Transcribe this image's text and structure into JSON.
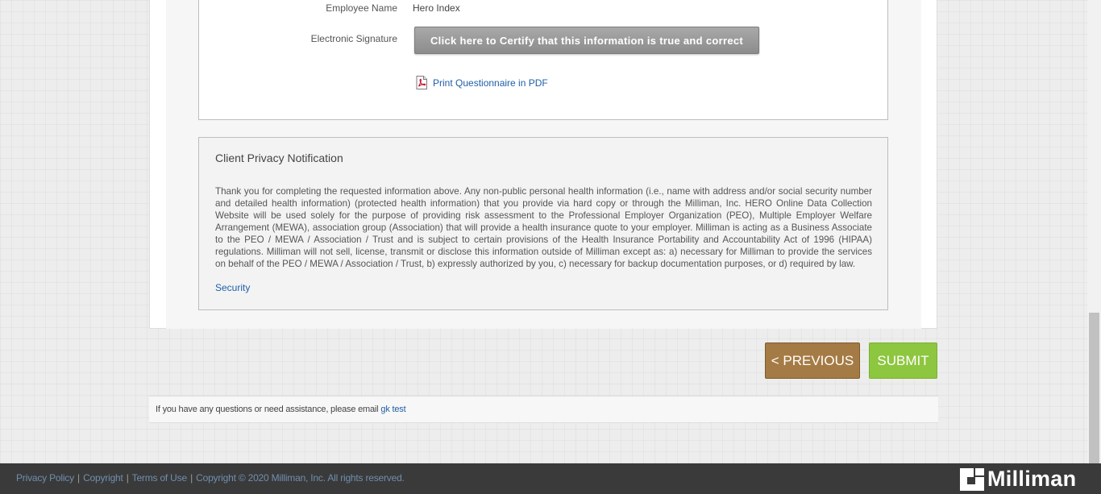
{
  "form": {
    "employee_name_label": "Employee Name",
    "employee_name_value": "Hero Index",
    "signature_label": "Electronic Signature",
    "certify_button": "Click here to Certify that this information is true and correct",
    "print_pdf_link": "Print Questionnaire in PDF"
  },
  "privacy": {
    "title": "Client Privacy Notification",
    "body": "Thank you for completing the requested information above. Any non-public personal health information (i.e., name with address and/or social security number and detailed health information) (protected health information) that you provide via hard copy or through the Milliman, Inc. HERO Online Data Collection Website will be used solely for the purpose of providing risk assessment to the Professional Employer Organization (PEO), Multiple Employer Welfare Arrangement (MEWA), association group (Association) that will provide a health insurance quote to your employer. Milliman is acting as a Business Associate to the PEO / MEWA / Association / Trust and is subject to certain provisions of the Health Insurance Portability and Accountability Act of 1996 (HIPAA) regulations. Milliman will not sell, license, transmit or disclose this information outside of Milliman except as: a) necessary for Milliman to provide the services on behalf of the PEO / MEWA / Association / Trust, b) expressly authorized by you, c) necessary for backup documentation purposes, or d) required by law.",
    "security_link": "Security"
  },
  "nav": {
    "previous_button": "< PREVIOUS",
    "submit_button": "SUBMIT"
  },
  "help": {
    "text": "If you have any questions or need assistance, please email",
    "link": "gk test"
  },
  "footer": {
    "privacy_policy": "Privacy Policy",
    "copyright": "Copyright",
    "terms_of_use": "Terms of Use",
    "copyright_notice": "Copyright © 2020 Milliman, Inc. All rights reserved.",
    "separator": "|",
    "logo_text": "Milliman"
  },
  "colors": {
    "previous_button": "#a57b45",
    "submit_button": "#8dc63f",
    "link": "#1f5fa8",
    "footer": "#3a3a3a"
  },
  "icons": [
    "pdf-icon",
    "milliman-logo-mark"
  ]
}
